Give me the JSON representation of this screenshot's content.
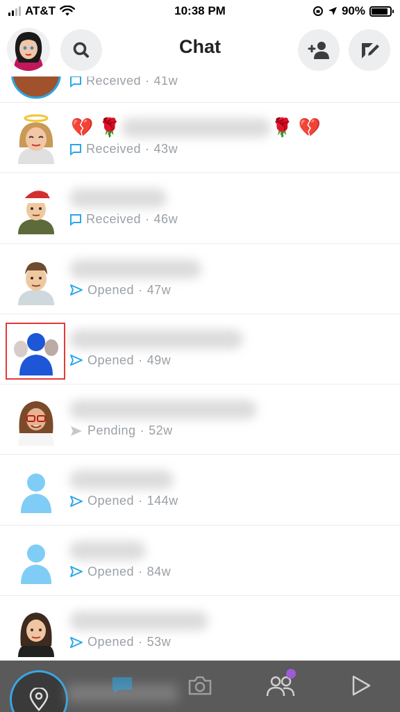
{
  "status_bar": {
    "carrier": "AT&T",
    "time": "10:38 PM",
    "battery": "90%"
  },
  "header": {
    "title": "Chat",
    "search_icon": "search-icon",
    "add_friend_icon": "add-friend-icon",
    "new_chat_icon": "new-chat-icon"
  },
  "chats": [
    {
      "status": "Received",
      "age": "41w",
      "kind": "received"
    },
    {
      "status": "Received",
      "age": "43w",
      "kind": "received",
      "name_emoji_left": "💔 🌹",
      "name_emoji_right": "🌹 💔"
    },
    {
      "status": "Received",
      "age": "46w",
      "kind": "received"
    },
    {
      "status": "Opened",
      "age": "47w",
      "kind": "opened"
    },
    {
      "status": "Opened",
      "age": "49w",
      "kind": "opened"
    },
    {
      "status": "Pending",
      "age": "52w",
      "kind": "pending"
    },
    {
      "status": "Opened",
      "age": "144w",
      "kind": "opened"
    },
    {
      "status": "Opened",
      "age": "84w",
      "kind": "opened"
    },
    {
      "status": "Opened",
      "age": "53w",
      "kind": "opened"
    }
  ],
  "colors": {
    "received": "#2aa7e8",
    "opened": "#2aa7e8",
    "pending": "#c8c8c8",
    "highlight": "#e53935",
    "nav_bg": "#5a5a5a"
  },
  "bottom_nav": {
    "items": [
      "map-icon",
      "chat-icon",
      "camera-icon",
      "friends-icon",
      "discover-icon"
    ]
  }
}
